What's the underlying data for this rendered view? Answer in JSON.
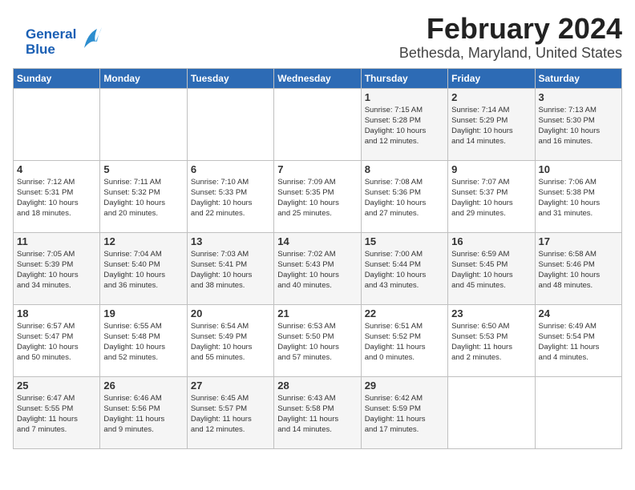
{
  "logo": {
    "general": "General",
    "blue": "Blue"
  },
  "header": {
    "month": "February 2024",
    "location": "Bethesda, Maryland, United States"
  },
  "weekdays": [
    "Sunday",
    "Monday",
    "Tuesday",
    "Wednesday",
    "Thursday",
    "Friday",
    "Saturday"
  ],
  "weeks": [
    [
      {
        "day": "",
        "info": ""
      },
      {
        "day": "",
        "info": ""
      },
      {
        "day": "",
        "info": ""
      },
      {
        "day": "",
        "info": ""
      },
      {
        "day": "1",
        "info": "Sunrise: 7:15 AM\nSunset: 5:28 PM\nDaylight: 10 hours\nand 12 minutes."
      },
      {
        "day": "2",
        "info": "Sunrise: 7:14 AM\nSunset: 5:29 PM\nDaylight: 10 hours\nand 14 minutes."
      },
      {
        "day": "3",
        "info": "Sunrise: 7:13 AM\nSunset: 5:30 PM\nDaylight: 10 hours\nand 16 minutes."
      }
    ],
    [
      {
        "day": "4",
        "info": "Sunrise: 7:12 AM\nSunset: 5:31 PM\nDaylight: 10 hours\nand 18 minutes."
      },
      {
        "day": "5",
        "info": "Sunrise: 7:11 AM\nSunset: 5:32 PM\nDaylight: 10 hours\nand 20 minutes."
      },
      {
        "day": "6",
        "info": "Sunrise: 7:10 AM\nSunset: 5:33 PM\nDaylight: 10 hours\nand 22 minutes."
      },
      {
        "day": "7",
        "info": "Sunrise: 7:09 AM\nSunset: 5:35 PM\nDaylight: 10 hours\nand 25 minutes."
      },
      {
        "day": "8",
        "info": "Sunrise: 7:08 AM\nSunset: 5:36 PM\nDaylight: 10 hours\nand 27 minutes."
      },
      {
        "day": "9",
        "info": "Sunrise: 7:07 AM\nSunset: 5:37 PM\nDaylight: 10 hours\nand 29 minutes."
      },
      {
        "day": "10",
        "info": "Sunrise: 7:06 AM\nSunset: 5:38 PM\nDaylight: 10 hours\nand 31 minutes."
      }
    ],
    [
      {
        "day": "11",
        "info": "Sunrise: 7:05 AM\nSunset: 5:39 PM\nDaylight: 10 hours\nand 34 minutes."
      },
      {
        "day": "12",
        "info": "Sunrise: 7:04 AM\nSunset: 5:40 PM\nDaylight: 10 hours\nand 36 minutes."
      },
      {
        "day": "13",
        "info": "Sunrise: 7:03 AM\nSunset: 5:41 PM\nDaylight: 10 hours\nand 38 minutes."
      },
      {
        "day": "14",
        "info": "Sunrise: 7:02 AM\nSunset: 5:43 PM\nDaylight: 10 hours\nand 40 minutes."
      },
      {
        "day": "15",
        "info": "Sunrise: 7:00 AM\nSunset: 5:44 PM\nDaylight: 10 hours\nand 43 minutes."
      },
      {
        "day": "16",
        "info": "Sunrise: 6:59 AM\nSunset: 5:45 PM\nDaylight: 10 hours\nand 45 minutes."
      },
      {
        "day": "17",
        "info": "Sunrise: 6:58 AM\nSunset: 5:46 PM\nDaylight: 10 hours\nand 48 minutes."
      }
    ],
    [
      {
        "day": "18",
        "info": "Sunrise: 6:57 AM\nSunset: 5:47 PM\nDaylight: 10 hours\nand 50 minutes."
      },
      {
        "day": "19",
        "info": "Sunrise: 6:55 AM\nSunset: 5:48 PM\nDaylight: 10 hours\nand 52 minutes."
      },
      {
        "day": "20",
        "info": "Sunrise: 6:54 AM\nSunset: 5:49 PM\nDaylight: 10 hours\nand 55 minutes."
      },
      {
        "day": "21",
        "info": "Sunrise: 6:53 AM\nSunset: 5:50 PM\nDaylight: 10 hours\nand 57 minutes."
      },
      {
        "day": "22",
        "info": "Sunrise: 6:51 AM\nSunset: 5:52 PM\nDaylight: 11 hours\nand 0 minutes."
      },
      {
        "day": "23",
        "info": "Sunrise: 6:50 AM\nSunset: 5:53 PM\nDaylight: 11 hours\nand 2 minutes."
      },
      {
        "day": "24",
        "info": "Sunrise: 6:49 AM\nSunset: 5:54 PM\nDaylight: 11 hours\nand 4 minutes."
      }
    ],
    [
      {
        "day": "25",
        "info": "Sunrise: 6:47 AM\nSunset: 5:55 PM\nDaylight: 11 hours\nand 7 minutes."
      },
      {
        "day": "26",
        "info": "Sunrise: 6:46 AM\nSunset: 5:56 PM\nDaylight: 11 hours\nand 9 minutes."
      },
      {
        "day": "27",
        "info": "Sunrise: 6:45 AM\nSunset: 5:57 PM\nDaylight: 11 hours\nand 12 minutes."
      },
      {
        "day": "28",
        "info": "Sunrise: 6:43 AM\nSunset: 5:58 PM\nDaylight: 11 hours\nand 14 minutes."
      },
      {
        "day": "29",
        "info": "Sunrise: 6:42 AM\nSunset: 5:59 PM\nDaylight: 11 hours\nand 17 minutes."
      },
      {
        "day": "",
        "info": ""
      },
      {
        "day": "",
        "info": ""
      }
    ]
  ]
}
